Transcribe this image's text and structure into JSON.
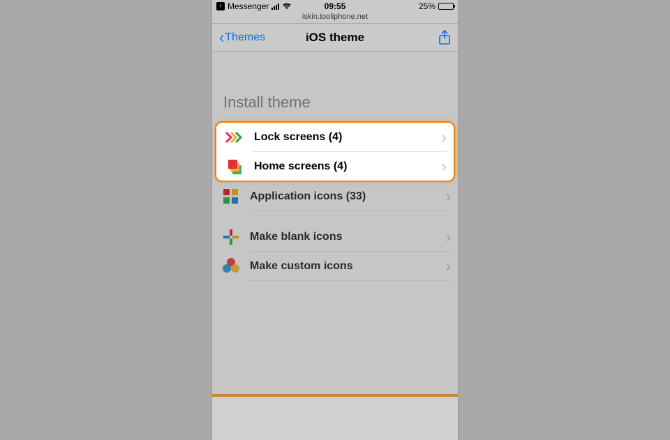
{
  "status_bar": {
    "back_app": "Messenger",
    "time": "09:55",
    "battery_pct": "25%"
  },
  "url": "iskin.tooliphone.net",
  "nav": {
    "back_label": "Themes",
    "title": "iOS theme"
  },
  "section_title": "Install theme",
  "rows": {
    "lock_screens": "Lock screens (4)",
    "home_screens": "Home screens (4)",
    "app_icons": "Application icons (33)",
    "blank_icons": "Make blank icons",
    "custom_icons": "Make custom icons"
  }
}
